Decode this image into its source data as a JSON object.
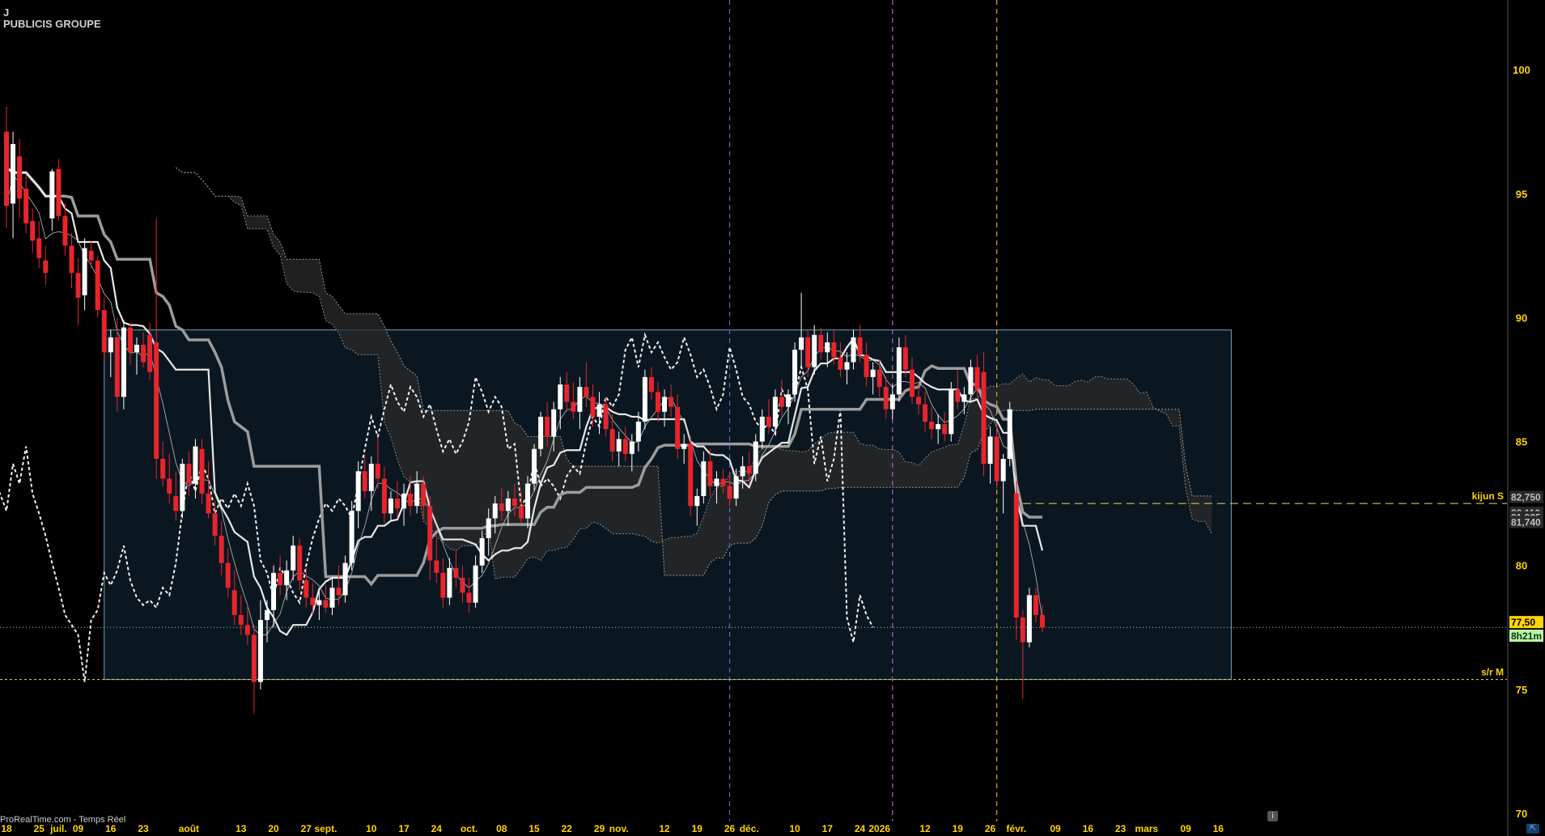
{
  "header": {
    "interval": "J",
    "instrument": "PUBLICIS GROUPE"
  },
  "footer": {
    "source": "ProRealTime.com - Temps Réel"
  },
  "icons": {
    "info": "info-icon",
    "corner": "expand-icon"
  },
  "colors": {
    "background": "#000000",
    "axis_label": "#ffd400",
    "candle_up": "#ffffff",
    "candle_down": "#e8242c",
    "range_box_fill": "#0b1720",
    "range_box_border": "#6f9fbf",
    "cloud_fill": "#2b2b2b",
    "price_tag_bg": "#ffd400",
    "timer_tag_bg": "#b9f2a6"
  },
  "chart_data": {
    "type": "candlestick",
    "ylim": [
      70,
      102
    ],
    "y_ticks": [
      70,
      75,
      80,
      85,
      90,
      95,
      100
    ],
    "x_tick_labels": [
      {
        "i": 0,
        "label": "18"
      },
      {
        "i": 5,
        "label": "25"
      },
      {
        "i": 8,
        "label": "juil."
      },
      {
        "i": 11,
        "label": "09"
      },
      {
        "i": 16,
        "label": "16"
      },
      {
        "i": 21,
        "label": "23"
      },
      {
        "i": 28,
        "label": "août"
      },
      {
        "i": 36,
        "label": "13"
      },
      {
        "i": 41,
        "label": "20"
      },
      {
        "i": 46,
        "label": "27"
      },
      {
        "i": 49,
        "label": "sept."
      },
      {
        "i": 56,
        "label": "10"
      },
      {
        "i": 61,
        "label": "17"
      },
      {
        "i": 66,
        "label": "24"
      },
      {
        "i": 71,
        "label": "oct."
      },
      {
        "i": 76,
        "label": "08"
      },
      {
        "i": 81,
        "label": "15"
      },
      {
        "i": 86,
        "label": "22"
      },
      {
        "i": 91,
        "label": "29"
      },
      {
        "i": 94,
        "label": "nov."
      },
      {
        "i": 101,
        "label": "12"
      },
      {
        "i": 106,
        "label": "19"
      },
      {
        "i": 111,
        "label": "26"
      },
      {
        "i": 114,
        "label": "déc."
      },
      {
        "i": 121,
        "label": "10"
      },
      {
        "i": 126,
        "label": "17"
      },
      {
        "i": 131,
        "label": "24"
      },
      {
        "i": 134,
        "label": "2026"
      },
      {
        "i": 141,
        "label": "12"
      },
      {
        "i": 146,
        "label": "19"
      },
      {
        "i": 151,
        "label": "26"
      },
      {
        "i": 155,
        "label": "févr."
      },
      {
        "i": 161,
        "label": "09"
      },
      {
        "i": 166,
        "label": "16"
      },
      {
        "i": 171,
        "label": "23"
      },
      {
        "i": 175,
        "label": "mars"
      },
      {
        "i": 181,
        "label": "09"
      },
      {
        "i": 186,
        "label": "16"
      }
    ],
    "candles": [
      [
        97.5,
        98.5,
        93.6,
        94.5
      ],
      [
        94.6,
        97.5,
        93.2,
        97.0
      ],
      [
        96.5,
        97.2,
        94.0,
        94.8
      ],
      [
        95.2,
        95.8,
        93.4,
        93.8
      ],
      [
        93.9,
        94.4,
        92.6,
        93.1
      ],
      [
        93.2,
        93.9,
        92.0,
        92.4
      ],
      [
        92.3,
        92.9,
        91.3,
        91.8
      ],
      [
        94.0,
        96.0,
        93.5,
        95.9
      ],
      [
        96.0,
        96.4,
        93.9,
        94.1
      ],
      [
        94.1,
        94.6,
        92.5,
        92.9
      ],
      [
        92.9,
        93.4,
        91.2,
        91.8
      ],
      [
        91.8,
        92.4,
        89.7,
        90.8
      ],
      [
        90.9,
        93.2,
        90.3,
        92.8
      ],
      [
        92.7,
        93.1,
        92.0,
        92.3
      ],
      [
        92.3,
        92.5,
        90.0,
        90.3
      ],
      [
        90.3,
        90.8,
        88.2,
        88.6
      ],
      [
        88.6,
        89.5,
        87.6,
        89.2
      ],
      [
        89.2,
        90.0,
        86.2,
        86.8
      ],
      [
        86.8,
        89.9,
        86.3,
        89.6
      ],
      [
        89.6,
        89.8,
        88.1,
        88.6
      ],
      [
        88.6,
        89.2,
        87.7,
        88.9
      ],
      [
        88.9,
        89.4,
        88.0,
        88.2
      ],
      [
        89.3,
        89.8,
        87.5,
        87.8
      ],
      [
        89.0,
        94.0,
        83.5,
        84.3
      ],
      [
        84.3,
        85.0,
        83.2,
        83.5
      ],
      [
        83.5,
        84.5,
        82.5,
        82.9
      ],
      [
        82.8,
        83.8,
        81.8,
        82.2
      ],
      [
        82.2,
        84.3,
        81.9,
        84.1
      ],
      [
        84.1,
        84.6,
        82.8,
        83.3
      ],
      [
        83.3,
        85.1,
        82.7,
        84.8
      ],
      [
        84.7,
        85.1,
        82.5,
        82.9
      ],
      [
        82.9,
        84.2,
        81.9,
        82.1
      ],
      [
        82.1,
        82.6,
        80.8,
        81.2
      ],
      [
        81.2,
        81.8,
        79.6,
        80.1
      ],
      [
        80.1,
        80.7,
        78.7,
        79.1
      ],
      [
        79.0,
        79.8,
        77.6,
        78.0
      ],
      [
        78.0,
        78.8,
        77.2,
        77.6
      ],
      [
        77.6,
        78.4,
        76.8,
        77.2
      ],
      [
        77.2,
        77.6,
        74.0,
        75.3
      ],
      [
        75.3,
        78.6,
        75.0,
        77.8
      ],
      [
        77.8,
        78.6,
        76.9,
        78.2
      ],
      [
        78.2,
        80.0,
        77.5,
        79.7
      ],
      [
        79.7,
        80.4,
        78.8,
        79.2
      ],
      [
        79.2,
        80.2,
        78.6,
        79.8
      ],
      [
        79.8,
        81.2,
        79.4,
        80.8
      ],
      [
        80.8,
        81.1,
        79.0,
        79.4
      ],
      [
        79.4,
        79.9,
        78.3,
        78.7
      ],
      [
        78.7,
        79.3,
        78.0,
        78.4
      ],
      [
        78.4,
        79.0,
        77.8,
        78.6
      ],
      [
        78.6,
        79.2,
        78.1,
        78.3
      ],
      [
        78.3,
        79.5,
        78.0,
        79.1
      ],
      [
        79.1,
        80.0,
        78.4,
        78.8
      ],
      [
        78.8,
        80.4,
        78.5,
        80.1
      ],
      [
        80.1,
        82.6,
        79.8,
        82.2
      ],
      [
        82.2,
        84.2,
        81.5,
        83.8
      ],
      [
        83.8,
        84.5,
        82.7,
        83.0
      ],
      [
        83.0,
        84.4,
        82.2,
        84.1
      ],
      [
        84.1,
        85.2,
        83.1,
        83.5
      ],
      [
        83.5,
        84.0,
        81.7,
        82.1
      ],
      [
        82.1,
        83.0,
        81.8,
        82.7
      ],
      [
        82.7,
        83.4,
        81.9,
        82.3
      ],
      [
        82.3,
        83.3,
        81.6,
        82.9
      ],
      [
        82.9,
        83.6,
        82.0,
        82.4
      ],
      [
        82.4,
        83.8,
        82.1,
        83.3
      ],
      [
        83.3,
        83.6,
        81.9,
        82.4
      ],
      [
        82.4,
        82.8,
        79.4,
        80.2
      ],
      [
        80.2,
        81.1,
        79.3,
        79.7
      ],
      [
        79.7,
        80.3,
        78.3,
        78.7
      ],
      [
        78.7,
        80.3,
        78.4,
        79.9
      ],
      [
        79.9,
        80.6,
        79.1,
        79.5
      ],
      [
        79.5,
        80.0,
        78.5,
        78.9
      ],
      [
        78.9,
        79.5,
        78.1,
        78.5
      ],
      [
        78.5,
        80.4,
        78.3,
        80.0
      ],
      [
        80.0,
        81.4,
        79.7,
        81.1
      ],
      [
        81.1,
        82.3,
        80.4,
        81.9
      ],
      [
        81.9,
        82.8,
        81.3,
        82.5
      ],
      [
        82.5,
        83.1,
        81.8,
        82.2
      ],
      [
        82.2,
        83.0,
        81.6,
        82.7
      ],
      [
        82.7,
        83.3,
        82.0,
        82.4
      ],
      [
        82.4,
        83.0,
        81.7,
        81.9
      ],
      [
        81.9,
        83.6,
        81.5,
        83.3
      ],
      [
        83.3,
        84.9,
        83.0,
        84.7
      ],
      [
        84.7,
        86.2,
        84.4,
        86.0
      ],
      [
        86.0,
        86.6,
        84.8,
        85.2
      ],
      [
        85.2,
        86.6,
        84.6,
        86.3
      ],
      [
        86.3,
        87.6,
        85.5,
        87.3
      ],
      [
        87.3,
        87.8,
        86.2,
        86.6
      ],
      [
        86.6,
        87.4,
        85.9,
        86.2
      ],
      [
        86.2,
        87.6,
        85.5,
        87.2
      ],
      [
        87.2,
        88.2,
        86.4,
        86.8
      ],
      [
        86.8,
        87.3,
        85.6,
        86.0
      ],
      [
        86.0,
        87.0,
        85.3,
        86.5
      ],
      [
        86.5,
        86.8,
        85.2,
        85.5
      ],
      [
        85.5,
        86.1,
        84.2,
        84.6
      ],
      [
        84.6,
        85.4,
        84.0,
        85.1
      ],
      [
        85.1,
        85.6,
        84.2,
        84.5
      ],
      [
        84.5,
        85.3,
        83.8,
        85.0
      ],
      [
        85.0,
        86.2,
        84.6,
        85.8
      ],
      [
        85.8,
        87.9,
        85.5,
        87.6
      ],
      [
        87.6,
        88.0,
        86.7,
        87.0
      ],
      [
        87.0,
        87.4,
        85.8,
        86.2
      ],
      [
        86.2,
        87.1,
        85.6,
        86.8
      ],
      [
        86.8,
        87.3,
        86.0,
        86.4
      ],
      [
        86.4,
        86.9,
        84.3,
        84.7
      ],
      [
        84.7,
        85.3,
        84.1,
        84.9
      ],
      [
        84.9,
        85.2,
        82.0,
        82.4
      ],
      [
        82.4,
        83.1,
        81.6,
        82.8
      ],
      [
        82.8,
        84.6,
        82.5,
        84.2
      ],
      [
        84.2,
        84.7,
        82.8,
        83.2
      ],
      [
        83.2,
        83.8,
        82.5,
        83.5
      ],
      [
        83.5,
        83.9,
        82.9,
        83.2
      ],
      [
        83.2,
        83.7,
        82.4,
        82.7
      ],
      [
        82.7,
        83.9,
        82.4,
        83.6
      ],
      [
        83.6,
        84.4,
        83.1,
        84.0
      ],
      [
        84.0,
        84.6,
        83.3,
        83.7
      ],
      [
        83.7,
        85.3,
        83.4,
        85.0
      ],
      [
        85.0,
        86.3,
        84.7,
        86.0
      ],
      [
        86.0,
        86.7,
        85.3,
        85.6
      ],
      [
        85.6,
        87.1,
        85.3,
        86.8
      ],
      [
        86.8,
        87.5,
        86.0,
        86.4
      ],
      [
        86.4,
        87.1,
        85.7,
        86.9
      ],
      [
        86.9,
        89.0,
        86.6,
        88.7
      ],
      [
        88.7,
        91.0,
        88.0,
        89.2
      ],
      [
        89.2,
        89.5,
        87.6,
        88.0
      ],
      [
        88.0,
        89.7,
        87.7,
        89.3
      ],
      [
        89.3,
        89.6,
        88.3,
        88.6
      ],
      [
        88.6,
        89.4,
        88.0,
        89.0
      ],
      [
        89.0,
        89.5,
        88.1,
        88.4
      ],
      [
        88.4,
        89.0,
        87.6,
        87.9
      ],
      [
        87.9,
        88.6,
        87.3,
        88.2
      ],
      [
        88.2,
        89.5,
        87.9,
        89.2
      ],
      [
        89.2,
        89.7,
        88.2,
        88.5
      ],
      [
        88.5,
        89.0,
        87.2,
        87.6
      ],
      [
        87.6,
        88.2,
        86.9,
        87.9
      ],
      [
        87.9,
        88.3,
        86.8,
        87.2
      ],
      [
        87.2,
        87.6,
        85.9,
        86.3
      ],
      [
        86.3,
        87.3,
        85.9,
        86.9
      ],
      [
        86.9,
        89.2,
        86.6,
        88.8
      ],
      [
        88.8,
        89.3,
        87.6,
        87.9
      ],
      [
        87.9,
        88.4,
        86.5,
        86.8
      ],
      [
        86.8,
        87.4,
        86.1,
        86.5
      ],
      [
        86.5,
        87.0,
        85.4,
        85.8
      ],
      [
        85.8,
        86.4,
        85.1,
        85.5
      ],
      [
        85.5,
        86.1,
        84.9,
        85.7
      ],
      [
        85.7,
        86.2,
        85.0,
        85.3
      ],
      [
        85.3,
        87.4,
        85.0,
        87.1
      ],
      [
        87.1,
        87.9,
        86.3,
        86.6
      ],
      [
        86.6,
        87.2,
        86.1,
        86.9
      ],
      [
        86.9,
        88.3,
        86.6,
        88.0
      ],
      [
        88.0,
        88.5,
        86.8,
        87.1
      ],
      [
        87.8,
        88.6,
        83.6,
        84.1
      ],
      [
        84.1,
        85.6,
        83.3,
        85.2
      ],
      [
        85.2,
        85.7,
        83.1,
        83.4
      ],
      [
        83.4,
        84.5,
        82.1,
        84.3
      ],
      [
        84.3,
        86.6,
        84.0,
        86.3
      ],
      [
        82.9,
        83.4,
        77.0,
        77.9
      ],
      [
        77.9,
        78.2,
        74.6,
        76.9
      ],
      [
        76.9,
        79.1,
        76.7,
        78.8
      ],
      [
        78.8,
        79.1,
        77.7,
        78.0
      ],
      [
        78.0,
        78.4,
        77.3,
        77.5
      ]
    ],
    "markers": [
      {
        "name": "s/r M",
        "value": 75.4
      },
      {
        "name": "kijun S",
        "value": 82.5
      }
    ],
    "right_tags": [
      {
        "text": "82,750",
        "value": 82.75,
        "style": "grey"
      },
      {
        "text": "82,110",
        "value": 82.11,
        "style": "grey"
      },
      {
        "text": "81,925",
        "value": 81.925,
        "style": "grey"
      },
      {
        "text": "81,740",
        "value": 81.74,
        "style": "grey"
      },
      {
        "text": "77,50",
        "value": 77.7,
        "style": "price"
      },
      {
        "text": "8h21m",
        "value": 77.15,
        "style": "timer"
      }
    ],
    "range_box": {
      "from_index": 15,
      "to_index": 188,
      "low": 75.4,
      "high": 89.5
    }
  }
}
